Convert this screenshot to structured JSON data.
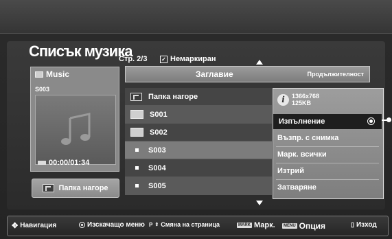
{
  "header": {
    "title": "Списък музика",
    "page_info": "Стр. 2/3",
    "unmarked": "Немаркиран"
  },
  "left_panel": {
    "folder_name": "Music",
    "current_file": "S003",
    "time": "00:00/01:34",
    "up_button_label": "Папка нагоре"
  },
  "list": {
    "col_title": "Заглавие",
    "col_duration": "Продължителност",
    "items": [
      {
        "label": "Папка нагоре",
        "type": "up"
      },
      {
        "label": "S001",
        "type": "folder"
      },
      {
        "label": "S002",
        "type": "folder"
      },
      {
        "label": "S003",
        "type": "file"
      },
      {
        "label": "S004",
        "type": "file"
      },
      {
        "label": "S005",
        "type": "file"
      }
    ]
  },
  "popup": {
    "resolution": "1366x768",
    "size": "125KB",
    "items": [
      "Изпълнение",
      "Възпр. с снимка",
      "Марк. всички",
      "Изтрий",
      "Затваряне"
    ],
    "selected_index": 0
  },
  "footer": {
    "nav": "Навигация",
    "popup_menu": "Изскачащо меню",
    "page_change": "Смяна на страница",
    "mark": "Марк.",
    "option": "Опция",
    "exit": "Изход",
    "p_key": "P",
    "mark_key": "MARK",
    "menu_key": "MENU"
  },
  "colors": {
    "background": "#2a2a2a",
    "panel": "#8a8a8a",
    "selected_row": "#7c7c7c",
    "popup_selected": "#1e1e1e"
  }
}
